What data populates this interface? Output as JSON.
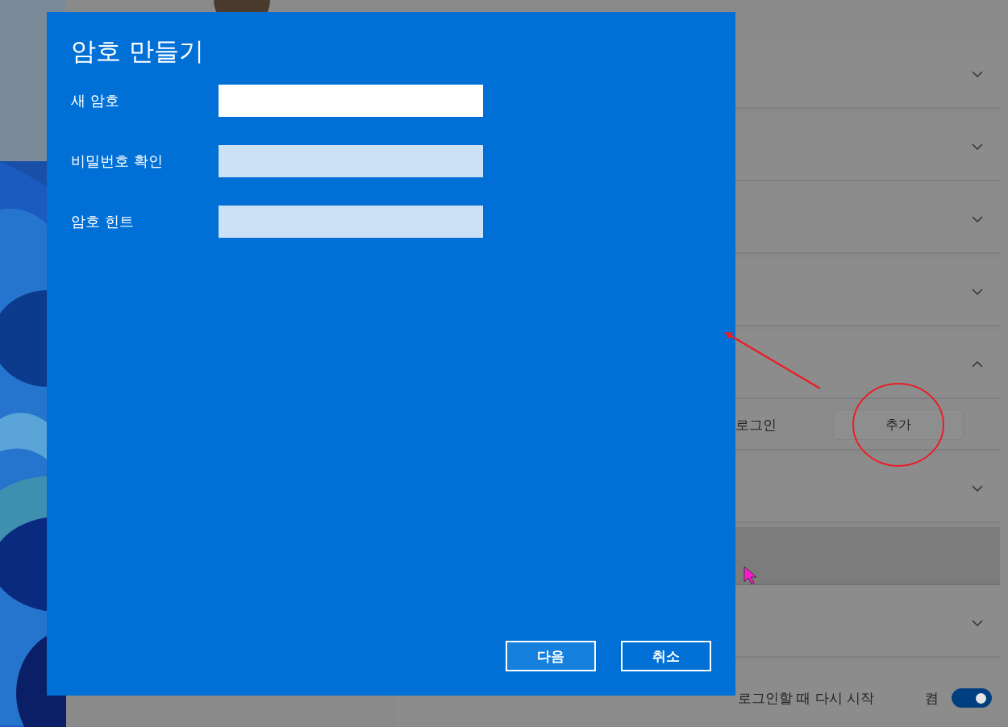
{
  "settings": {
    "rows": [
      {
        "kind": "collapsible",
        "expanded": false
      },
      {
        "kind": "collapsible",
        "expanded": false
      },
      {
        "kind": "collapsible",
        "expanded": false
      },
      {
        "kind": "collapsible",
        "expanded": false
      },
      {
        "kind": "collapsible",
        "expanded": true
      },
      {
        "kind": "action",
        "label": "로그인",
        "button": "추가"
      },
      {
        "kind": "collapsible",
        "expanded": false
      },
      {
        "kind": "plain",
        "hovered": true
      },
      {
        "kind": "collapsible",
        "expanded": false
      },
      {
        "kind": "toggle",
        "label": "로그인할 때 다시 시작",
        "state_text": "켬",
        "on": true
      }
    ]
  },
  "dialog": {
    "title": "암호 만들기",
    "fields": [
      {
        "label": "새 암호",
        "focused": true
      },
      {
        "label": "비밀번호 확인",
        "focused": false
      },
      {
        "label": "암호 힌트",
        "focused": false
      }
    ],
    "buttons": [
      {
        "label": "다음",
        "default": true
      },
      {
        "label": "취소",
        "default": false
      }
    ]
  }
}
